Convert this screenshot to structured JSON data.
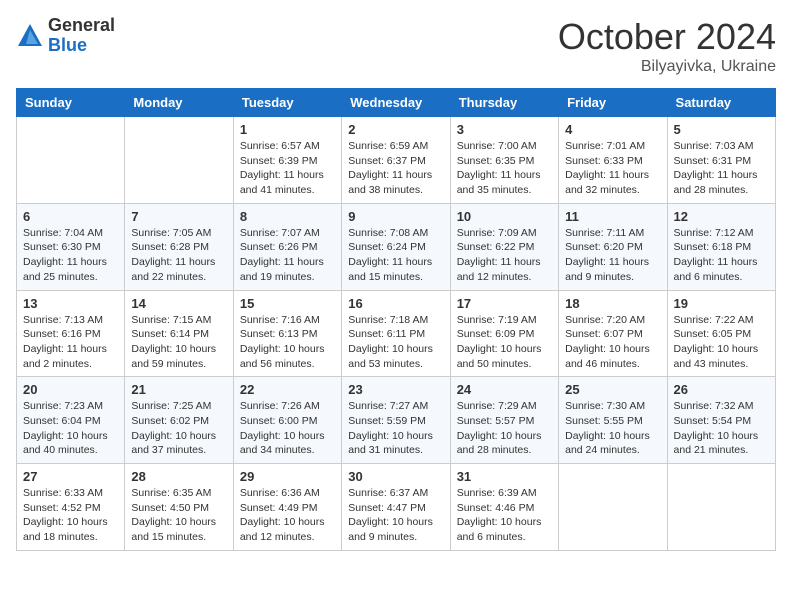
{
  "logo": {
    "general": "General",
    "blue": "Blue"
  },
  "title": {
    "month": "October 2024",
    "location": "Bilyayivka, Ukraine"
  },
  "headers": [
    "Sunday",
    "Monday",
    "Tuesday",
    "Wednesday",
    "Thursday",
    "Friday",
    "Saturday"
  ],
  "weeks": [
    [
      {
        "day": "",
        "sunrise": "",
        "sunset": "",
        "daylight": ""
      },
      {
        "day": "",
        "sunrise": "",
        "sunset": "",
        "daylight": ""
      },
      {
        "day": "1",
        "sunrise": "Sunrise: 6:57 AM",
        "sunset": "Sunset: 6:39 PM",
        "daylight": "Daylight: 11 hours and 41 minutes."
      },
      {
        "day": "2",
        "sunrise": "Sunrise: 6:59 AM",
        "sunset": "Sunset: 6:37 PM",
        "daylight": "Daylight: 11 hours and 38 minutes."
      },
      {
        "day": "3",
        "sunrise": "Sunrise: 7:00 AM",
        "sunset": "Sunset: 6:35 PM",
        "daylight": "Daylight: 11 hours and 35 minutes."
      },
      {
        "day": "4",
        "sunrise": "Sunrise: 7:01 AM",
        "sunset": "Sunset: 6:33 PM",
        "daylight": "Daylight: 11 hours and 32 minutes."
      },
      {
        "day": "5",
        "sunrise": "Sunrise: 7:03 AM",
        "sunset": "Sunset: 6:31 PM",
        "daylight": "Daylight: 11 hours and 28 minutes."
      }
    ],
    [
      {
        "day": "6",
        "sunrise": "Sunrise: 7:04 AM",
        "sunset": "Sunset: 6:30 PM",
        "daylight": "Daylight: 11 hours and 25 minutes."
      },
      {
        "day": "7",
        "sunrise": "Sunrise: 7:05 AM",
        "sunset": "Sunset: 6:28 PM",
        "daylight": "Daylight: 11 hours and 22 minutes."
      },
      {
        "day": "8",
        "sunrise": "Sunrise: 7:07 AM",
        "sunset": "Sunset: 6:26 PM",
        "daylight": "Daylight: 11 hours and 19 minutes."
      },
      {
        "day": "9",
        "sunrise": "Sunrise: 7:08 AM",
        "sunset": "Sunset: 6:24 PM",
        "daylight": "Daylight: 11 hours and 15 minutes."
      },
      {
        "day": "10",
        "sunrise": "Sunrise: 7:09 AM",
        "sunset": "Sunset: 6:22 PM",
        "daylight": "Daylight: 11 hours and 12 minutes."
      },
      {
        "day": "11",
        "sunrise": "Sunrise: 7:11 AM",
        "sunset": "Sunset: 6:20 PM",
        "daylight": "Daylight: 11 hours and 9 minutes."
      },
      {
        "day": "12",
        "sunrise": "Sunrise: 7:12 AM",
        "sunset": "Sunset: 6:18 PM",
        "daylight": "Daylight: 11 hours and 6 minutes."
      }
    ],
    [
      {
        "day": "13",
        "sunrise": "Sunrise: 7:13 AM",
        "sunset": "Sunset: 6:16 PM",
        "daylight": "Daylight: 11 hours and 2 minutes."
      },
      {
        "day": "14",
        "sunrise": "Sunrise: 7:15 AM",
        "sunset": "Sunset: 6:14 PM",
        "daylight": "Daylight: 10 hours and 59 minutes."
      },
      {
        "day": "15",
        "sunrise": "Sunrise: 7:16 AM",
        "sunset": "Sunset: 6:13 PM",
        "daylight": "Daylight: 10 hours and 56 minutes."
      },
      {
        "day": "16",
        "sunrise": "Sunrise: 7:18 AM",
        "sunset": "Sunset: 6:11 PM",
        "daylight": "Daylight: 10 hours and 53 minutes."
      },
      {
        "day": "17",
        "sunrise": "Sunrise: 7:19 AM",
        "sunset": "Sunset: 6:09 PM",
        "daylight": "Daylight: 10 hours and 50 minutes."
      },
      {
        "day": "18",
        "sunrise": "Sunrise: 7:20 AM",
        "sunset": "Sunset: 6:07 PM",
        "daylight": "Daylight: 10 hours and 46 minutes."
      },
      {
        "day": "19",
        "sunrise": "Sunrise: 7:22 AM",
        "sunset": "Sunset: 6:05 PM",
        "daylight": "Daylight: 10 hours and 43 minutes."
      }
    ],
    [
      {
        "day": "20",
        "sunrise": "Sunrise: 7:23 AM",
        "sunset": "Sunset: 6:04 PM",
        "daylight": "Daylight: 10 hours and 40 minutes."
      },
      {
        "day": "21",
        "sunrise": "Sunrise: 7:25 AM",
        "sunset": "Sunset: 6:02 PM",
        "daylight": "Daylight: 10 hours and 37 minutes."
      },
      {
        "day": "22",
        "sunrise": "Sunrise: 7:26 AM",
        "sunset": "Sunset: 6:00 PM",
        "daylight": "Daylight: 10 hours and 34 minutes."
      },
      {
        "day": "23",
        "sunrise": "Sunrise: 7:27 AM",
        "sunset": "Sunset: 5:59 PM",
        "daylight": "Daylight: 10 hours and 31 minutes."
      },
      {
        "day": "24",
        "sunrise": "Sunrise: 7:29 AM",
        "sunset": "Sunset: 5:57 PM",
        "daylight": "Daylight: 10 hours and 28 minutes."
      },
      {
        "day": "25",
        "sunrise": "Sunrise: 7:30 AM",
        "sunset": "Sunset: 5:55 PM",
        "daylight": "Daylight: 10 hours and 24 minutes."
      },
      {
        "day": "26",
        "sunrise": "Sunrise: 7:32 AM",
        "sunset": "Sunset: 5:54 PM",
        "daylight": "Daylight: 10 hours and 21 minutes."
      }
    ],
    [
      {
        "day": "27",
        "sunrise": "Sunrise: 6:33 AM",
        "sunset": "Sunset: 4:52 PM",
        "daylight": "Daylight: 10 hours and 18 minutes."
      },
      {
        "day": "28",
        "sunrise": "Sunrise: 6:35 AM",
        "sunset": "Sunset: 4:50 PM",
        "daylight": "Daylight: 10 hours and 15 minutes."
      },
      {
        "day": "29",
        "sunrise": "Sunrise: 6:36 AM",
        "sunset": "Sunset: 4:49 PM",
        "daylight": "Daylight: 10 hours and 12 minutes."
      },
      {
        "day": "30",
        "sunrise": "Sunrise: 6:37 AM",
        "sunset": "Sunset: 4:47 PM",
        "daylight": "Daylight: 10 hours and 9 minutes."
      },
      {
        "day": "31",
        "sunrise": "Sunrise: 6:39 AM",
        "sunset": "Sunset: 4:46 PM",
        "daylight": "Daylight: 10 hours and 6 minutes."
      },
      {
        "day": "",
        "sunrise": "",
        "sunset": "",
        "daylight": ""
      },
      {
        "day": "",
        "sunrise": "",
        "sunset": "",
        "daylight": ""
      }
    ]
  ]
}
